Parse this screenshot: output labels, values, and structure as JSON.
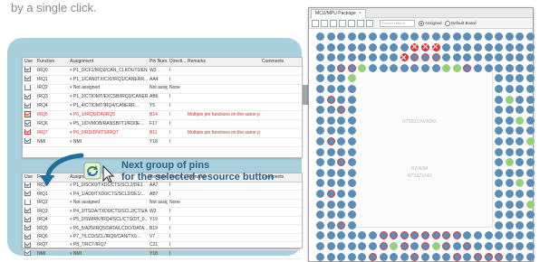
{
  "top_text": "by a single click.",
  "table1": {
    "columns": [
      "Use",
      "Function",
      "Assignment",
      "Pin Num...",
      "Directi...",
      "Remarks",
      "Comments"
    ],
    "rows": [
      {
        "checked": true,
        "red": false,
        "function": "IRQ0",
        "assignment": "P1_0/CF1/IRQ0/CAN_CLKOUT0/ENI",
        "pin": "W3",
        "dir": "I",
        "remarks": ""
      },
      {
        "checked": true,
        "red": false,
        "function": "IRQ1",
        "assignment": "P1_1/CAN0TX/CXI/IRQ1/CANERR...",
        "pin": "AA4",
        "dir": "I",
        "remarks": ""
      },
      {
        "checked": false,
        "red": false,
        "function": "IRQ2",
        "assignment": "Not assigned",
        "pin": "Not assign",
        "dir": "None",
        "remarks": ""
      },
      {
        "checked": true,
        "red": false,
        "function": "IRQ3",
        "assignment": "P1_3/CTIOMT/EXCSB/IRQ3/CANERR...",
        "pin": "AB6",
        "dir": "I",
        "remarks": ""
      },
      {
        "checked": true,
        "red": false,
        "function": "IRQ4",
        "assignment": "P1_4/CTIOMT/IRQ4/CANERR...",
        "pin": "Y5",
        "dir": "I",
        "remarks": ""
      },
      {
        "checked": true,
        "red": true,
        "function": "IRQ5",
        "assignment": "P6_1/IRQ5/DA/IRQ5",
        "pin": "B14",
        "dir": "I",
        "remarks": "Multiple pin functions on the same pin"
      },
      {
        "checked": true,
        "red": false,
        "function": "IRQ6",
        "assignment": "P5_1/DVMOB/RANSB/IT1/RD0E...",
        "pin": "F17",
        "dir": "I",
        "remarks": ""
      },
      {
        "checked": true,
        "red": true,
        "function": "IRQ7",
        "assignment": "P6_0/RD/DN/TS/IRQ7",
        "pin": "B11",
        "dir": "I",
        "remarks": "Multiple pin functions on the same pin"
      },
      {
        "checked": true,
        "red": false,
        "function": "NMI",
        "assignment": "NMI",
        "pin": "Y18",
        "dir": "I",
        "remarks": ""
      }
    ]
  },
  "table2": {
    "columns": [
      "Use",
      "Function",
      "Assignment",
      "Pin Num...",
      "Directi...",
      "Remarks",
      "Comments"
    ],
    "rows": [
      {
        "checked": true,
        "red": false,
        "function": "IRQ0",
        "assignment": "P1_0/SCK0/TXD1/CTS/SCL2/DE1",
        "pin": "AA7",
        "dir": "I",
        "remarks": ""
      },
      {
        "checked": true,
        "red": false,
        "function": "IRQ1",
        "assignment": "P4_1/AD0/TXD0/CTS/SCL2/DE1/...",
        "pin": "AB7",
        "dir": "I",
        "remarks": ""
      },
      {
        "checked": false,
        "red": false,
        "function": "IRQ2",
        "assignment": "Not assigned",
        "pin": "Not assign",
        "dir": "None",
        "remarks": ""
      },
      {
        "checked": true,
        "red": false,
        "function": "IRQ3",
        "assignment": "P4_3/TSDA/TXD0/CTS/SCL2/CTS/A...",
        "pin": "W3",
        "dir": "I",
        "remarks": ""
      },
      {
        "checked": true,
        "red": false,
        "function": "IRQ4",
        "assignment": "P5_0/SWIRK/IRQ4/SCL/CTS/DT_0...",
        "pin": "Y19",
        "dir": "I",
        "remarks": ""
      },
      {
        "checked": true,
        "red": false,
        "function": "IRQ5",
        "assignment": "P6_5/A25/IRQ5/DATA/LCDO/DATA...",
        "pin": "B19",
        "dir": "I",
        "remarks": ""
      },
      {
        "checked": true,
        "red": false,
        "function": "IRQ6",
        "assignment": "P7_7/LCD/SCL/IRQ6/CAN/TX0...",
        "pin": "V7",
        "dir": "I",
        "remarks": ""
      },
      {
        "checked": true,
        "red": false,
        "function": "IRQ7",
        "assignment": "P8_7/RCT/IRQ7",
        "pin": "C21",
        "dir": "I",
        "remarks": ""
      },
      {
        "checked": true,
        "red": false,
        "function": "NMI",
        "assignment": "NMI",
        "pin": "Y18",
        "dir": "I",
        "remarks": ""
      }
    ]
  },
  "callout": {
    "line1": "Next group of pins",
    "line2": "for the selected resource button"
  },
  "window": {
    "tab_label": "MCU/MPU Package",
    "search_placeholder": "Search criteria",
    "radio1": "Assigned",
    "radio2": "Default Board",
    "chip_label_1": "R7S9210W/MAX",
    "chip_label_2": "RZ/A2M",
    "chip_label_3": "R7S921043"
  },
  "colors": {
    "panel_bg": "#a9d1dd",
    "callout_text": "#2a5f86",
    "warning_red": "#e0262b",
    "pin_blue": "#5b8db8",
    "pin_green": "#98d07a",
    "pin_error": "#e23232"
  }
}
